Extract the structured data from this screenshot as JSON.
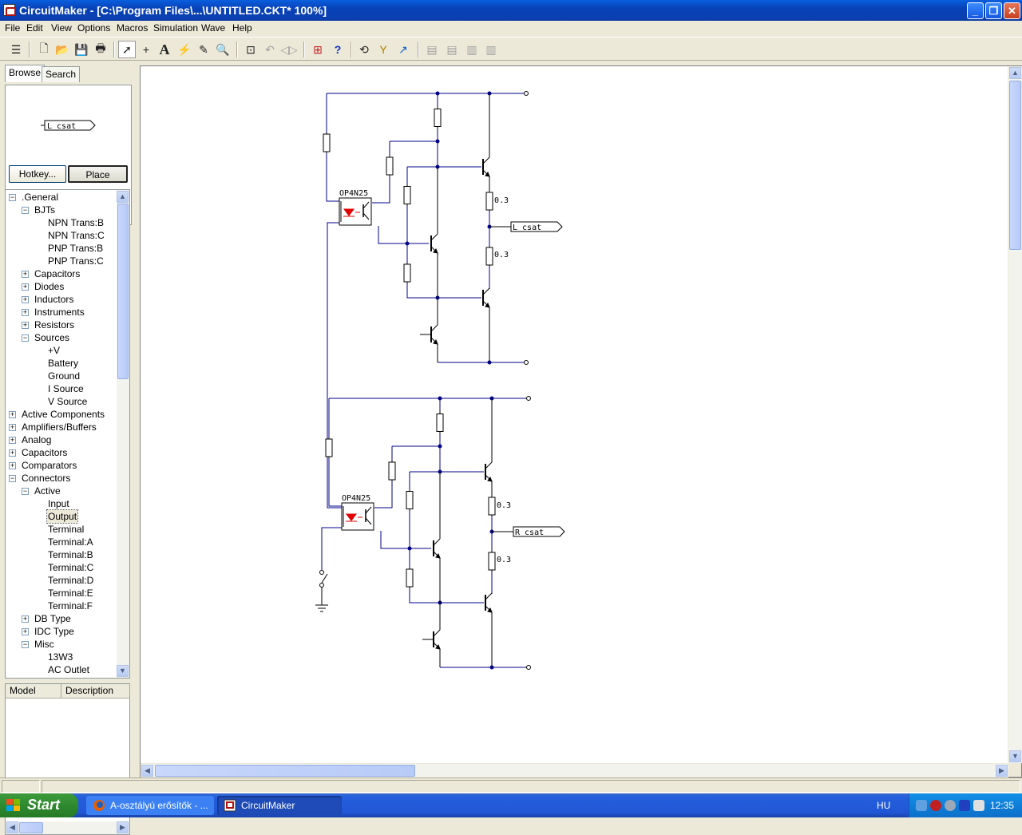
{
  "window": {
    "title": "CircuitMaker - [C:\\Program Files\\...\\UNTITLED.CKT* 100%]",
    "min_glyph": "_",
    "max_glyph": "❐",
    "close_glyph": "✕"
  },
  "menu": [
    "File",
    "Edit",
    "View",
    "Options",
    "Macros",
    "Simulation",
    "Wave",
    "Help"
  ],
  "toolbar": {
    "icons": [
      "layers-icon",
      "new-file-icon",
      "open-folder-icon",
      "save-icon",
      "print-icon",
      "arrow-tool-icon",
      "wire-tool-icon",
      "text-tool-icon",
      "probe-tool-icon",
      "pencil-tool-icon",
      "zoom-tool-icon",
      "zoom-fit-icon",
      "rotate-icon",
      "mirror-icon",
      "netlist-icon",
      "help-icon",
      "reset-icon",
      "step-icon",
      "run-icon"
    ]
  },
  "left_panel": {
    "tabs": [
      "Browse",
      "Search"
    ],
    "preview_label": "L csat",
    "hotkey_label": "Hotkey...",
    "place_label": "Place",
    "tree": [
      {
        "label": ".General",
        "level": 0,
        "exp": "-"
      },
      {
        "label": "BJTs",
        "level": 1,
        "exp": "-"
      },
      {
        "label": "NPN Trans:B",
        "level": 2
      },
      {
        "label": "NPN Trans:C",
        "level": 2
      },
      {
        "label": "PNP Trans:B",
        "level": 2
      },
      {
        "label": "PNP Trans:C",
        "level": 2
      },
      {
        "label": "Capacitors",
        "level": 1,
        "exp": "+"
      },
      {
        "label": "Diodes",
        "level": 1,
        "exp": "+"
      },
      {
        "label": "Inductors",
        "level": 1,
        "exp": "+"
      },
      {
        "label": "Instruments",
        "level": 1,
        "exp": "+"
      },
      {
        "label": "Resistors",
        "level": 1,
        "exp": "+"
      },
      {
        "label": "Sources",
        "level": 1,
        "exp": "-"
      },
      {
        "label": "+V",
        "level": 2
      },
      {
        "label": "Battery",
        "level": 2
      },
      {
        "label": "Ground",
        "level": 2
      },
      {
        "label": "I Source",
        "level": 2
      },
      {
        "label": "V Source",
        "level": 2
      },
      {
        "label": "Active Components",
        "level": 0,
        "exp": "+"
      },
      {
        "label": "Amplifiers/Buffers",
        "level": 0,
        "exp": "+"
      },
      {
        "label": "Analog",
        "level": 0,
        "exp": "+"
      },
      {
        "label": "Capacitors",
        "level": 0,
        "exp": "+"
      },
      {
        "label": "Comparators",
        "level": 0,
        "exp": "+"
      },
      {
        "label": "Connectors",
        "level": 0,
        "exp": "-"
      },
      {
        "label": "Active",
        "level": 1,
        "exp": "-"
      },
      {
        "label": "Input",
        "level": 2
      },
      {
        "label": "Output",
        "level": 2,
        "selected": true
      },
      {
        "label": "Terminal",
        "level": 2
      },
      {
        "label": "Terminal:A",
        "level": 2
      },
      {
        "label": "Terminal:B",
        "level": 2
      },
      {
        "label": "Terminal:C",
        "level": 2
      },
      {
        "label": "Terminal:D",
        "level": 2
      },
      {
        "label": "Terminal:E",
        "level": 2
      },
      {
        "label": "Terminal:F",
        "level": 2
      },
      {
        "label": "DB Type",
        "level": 1,
        "exp": "+"
      },
      {
        "label": "IDC Type",
        "level": 1,
        "exp": "+"
      },
      {
        "label": "Misc",
        "level": 1,
        "exp": "-"
      },
      {
        "label": "13W3",
        "level": 2
      },
      {
        "label": "AC Outlet",
        "level": 2
      }
    ],
    "model_columns": [
      "Model",
      "Description"
    ]
  },
  "schematic": {
    "opto_label": "OP4N25",
    "resistor_value": "0.3",
    "output_top": "L csat",
    "output_bottom": "R csat"
  },
  "taskbar": {
    "start_label": "Start",
    "tasks": [
      "A-osztályú erősítők - ...",
      "CircuitMaker"
    ],
    "language": "HU",
    "clock": "12:35"
  },
  "colors": {
    "wire": "#00008b",
    "part": "#000000",
    "led": "#e00000"
  }
}
